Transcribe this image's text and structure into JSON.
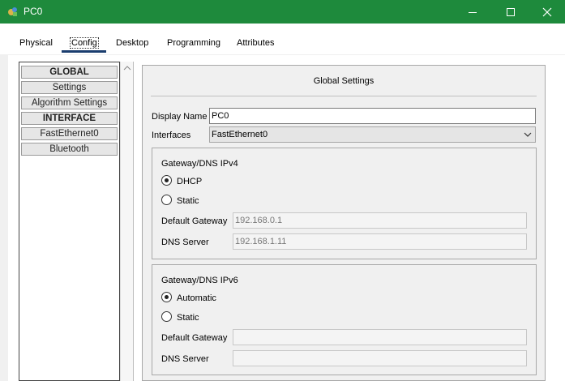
{
  "window": {
    "title": "PC0",
    "titlebar_color": "#1e8a3c",
    "icons": [
      "app-icon",
      "minimize-icon",
      "maximize-icon",
      "close-icon"
    ]
  },
  "tabs": [
    "Physical",
    "Config",
    "Desktop",
    "Programming",
    "Attributes"
  ],
  "active_tab": "Config",
  "sidebar": {
    "items": [
      "GLOBAL",
      "Settings",
      "Algorithm Settings",
      "INTERFACE",
      "FastEthernet0",
      "Bluetooth"
    ]
  },
  "panel": {
    "title": "Global Settings",
    "display_name_label": "Display Name",
    "display_name_value": "PC0",
    "interfaces_label": "Interfaces",
    "interfaces_value": "FastEthernet0"
  },
  "ipv4": {
    "title": "Gateway/DNS IPv4",
    "option_dhcp": "DHCP",
    "option_static": "Static",
    "selected": "DHCP",
    "gateway_label": "Default Gateway",
    "gateway_value": "192.168.0.1",
    "dns_label": "DNS Server",
    "dns_value": "192.168.1.11"
  },
  "ipv6": {
    "title": "Gateway/DNS IPv6",
    "option_automatic": "Automatic",
    "option_static": "Static",
    "selected": "Automatic",
    "gateway_label": "Default Gateway",
    "gateway_value": "",
    "dns_label": "DNS Server",
    "dns_value": ""
  }
}
